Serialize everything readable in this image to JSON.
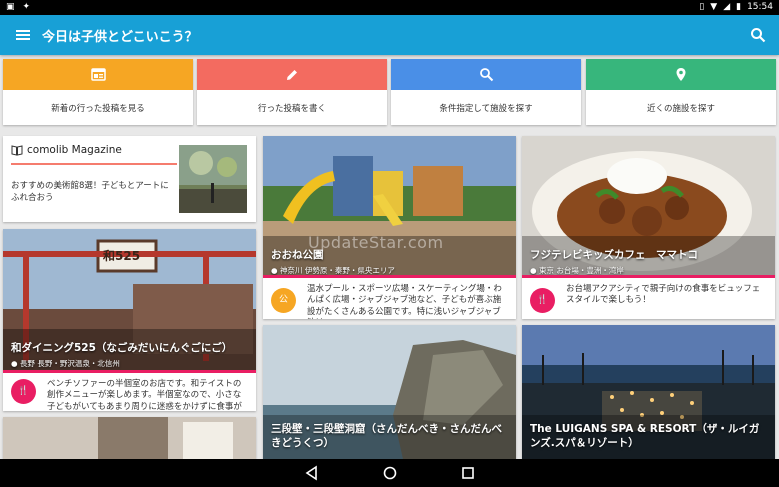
{
  "status": {
    "time": "15:54"
  },
  "app_bar": {
    "title": "今日は子供とどこいこう？"
  },
  "actions": [
    {
      "label": "新着の行った投稿を見る",
      "color": "#f6a623",
      "icon": "newspaper-icon"
    },
    {
      "label": "行った投稿を書く",
      "color": "#f36b60",
      "icon": "pencil-icon"
    },
    {
      "label": "条件指定して施設を探す",
      "color": "#4a8fe7",
      "icon": "search-icon"
    },
    {
      "label": "近くの施設を探す",
      "color": "#37b67c",
      "icon": "location-pin-icon"
    }
  ],
  "magazine": {
    "title": "comolib Magazine",
    "text": "おすすめの美術館8選！子どもとアートにふれ合おう"
  },
  "watermark": "UpdateStar.com",
  "cards": [
    {
      "name": "和ダイニング525（なごみだいにんぐごにご）",
      "location": "長野 長野・野沢温泉・北信州",
      "desc": "ベンチソファーの半個室のお店です。和テイストの創作メニューが楽しめます。半個室なので、小さな子どもがいてもあまり周りに迷惑をかけずに食事ができ",
      "sign": "和525"
    },
    {
      "name": "おおね公園",
      "location": "神奈川 伊勢原・秦野・県央エリア",
      "desc": "温水プール・スポーツ広場・スケーティング場・わんぱく広場・ジャブジャブ池など、子どもが喜ぶ施設がたくさんある公園です。特に浅いジャブジャブ池は…",
      "icon_text": "公"
    },
    {
      "name": "フジテレビキッズカフェ　ママトコ",
      "location": "東京 お台場・豊洲・湾岸",
      "desc": "お台場アクアシティで親子向けの食事をビュッフェスタイルで楽しもう！"
    },
    {
      "name": "三段壁・三段壁洞窟（さんだんべき・さんだんべきどうくつ）",
      "location": ""
    },
    {
      "name": "The LUIGANS SPA & RESORT（ザ・ルイガンズ.スパ＆リゾート）",
      "location": ""
    }
  ]
}
